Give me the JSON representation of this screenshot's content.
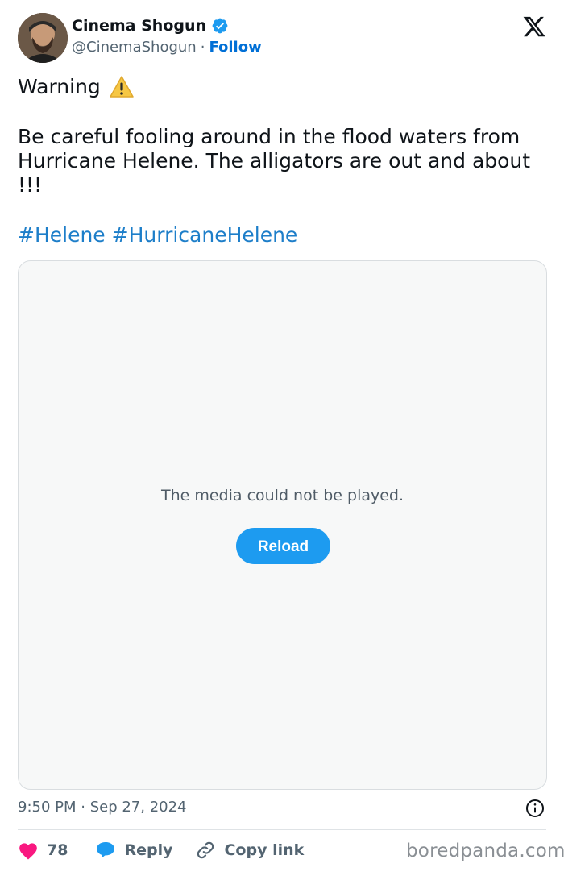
{
  "author": {
    "name": "Cinema Shogun",
    "handle": "@CinemaShogun",
    "separator": "·",
    "follow_label": "Follow",
    "verified": true,
    "avatar_icon": "avatar-photo"
  },
  "platform_icon": "x-logo-icon",
  "tweet": {
    "line1": "Warning",
    "line1_icon": "warning-sign-icon",
    "body": "Be careful fooling around in the flood waters from Hurricane Helene. The alligators are out and about !!!",
    "hashtags": [
      "#Helene",
      "#HurricaneHelene"
    ]
  },
  "media": {
    "message": "The media could not be played.",
    "reload_label": "Reload"
  },
  "meta": {
    "timestamp": "9:50 PM · Sep 27, 2024",
    "info_icon": "info-icon"
  },
  "actions": {
    "like_count": "78",
    "reply_label": "Reply",
    "copy_link_label": "Copy link"
  },
  "watermark": "boredpanda.com",
  "colors": {
    "accent": "#1d9bf0",
    "link": "#1d7ec9",
    "like": "#f91880",
    "secondary_text": "#536471"
  }
}
